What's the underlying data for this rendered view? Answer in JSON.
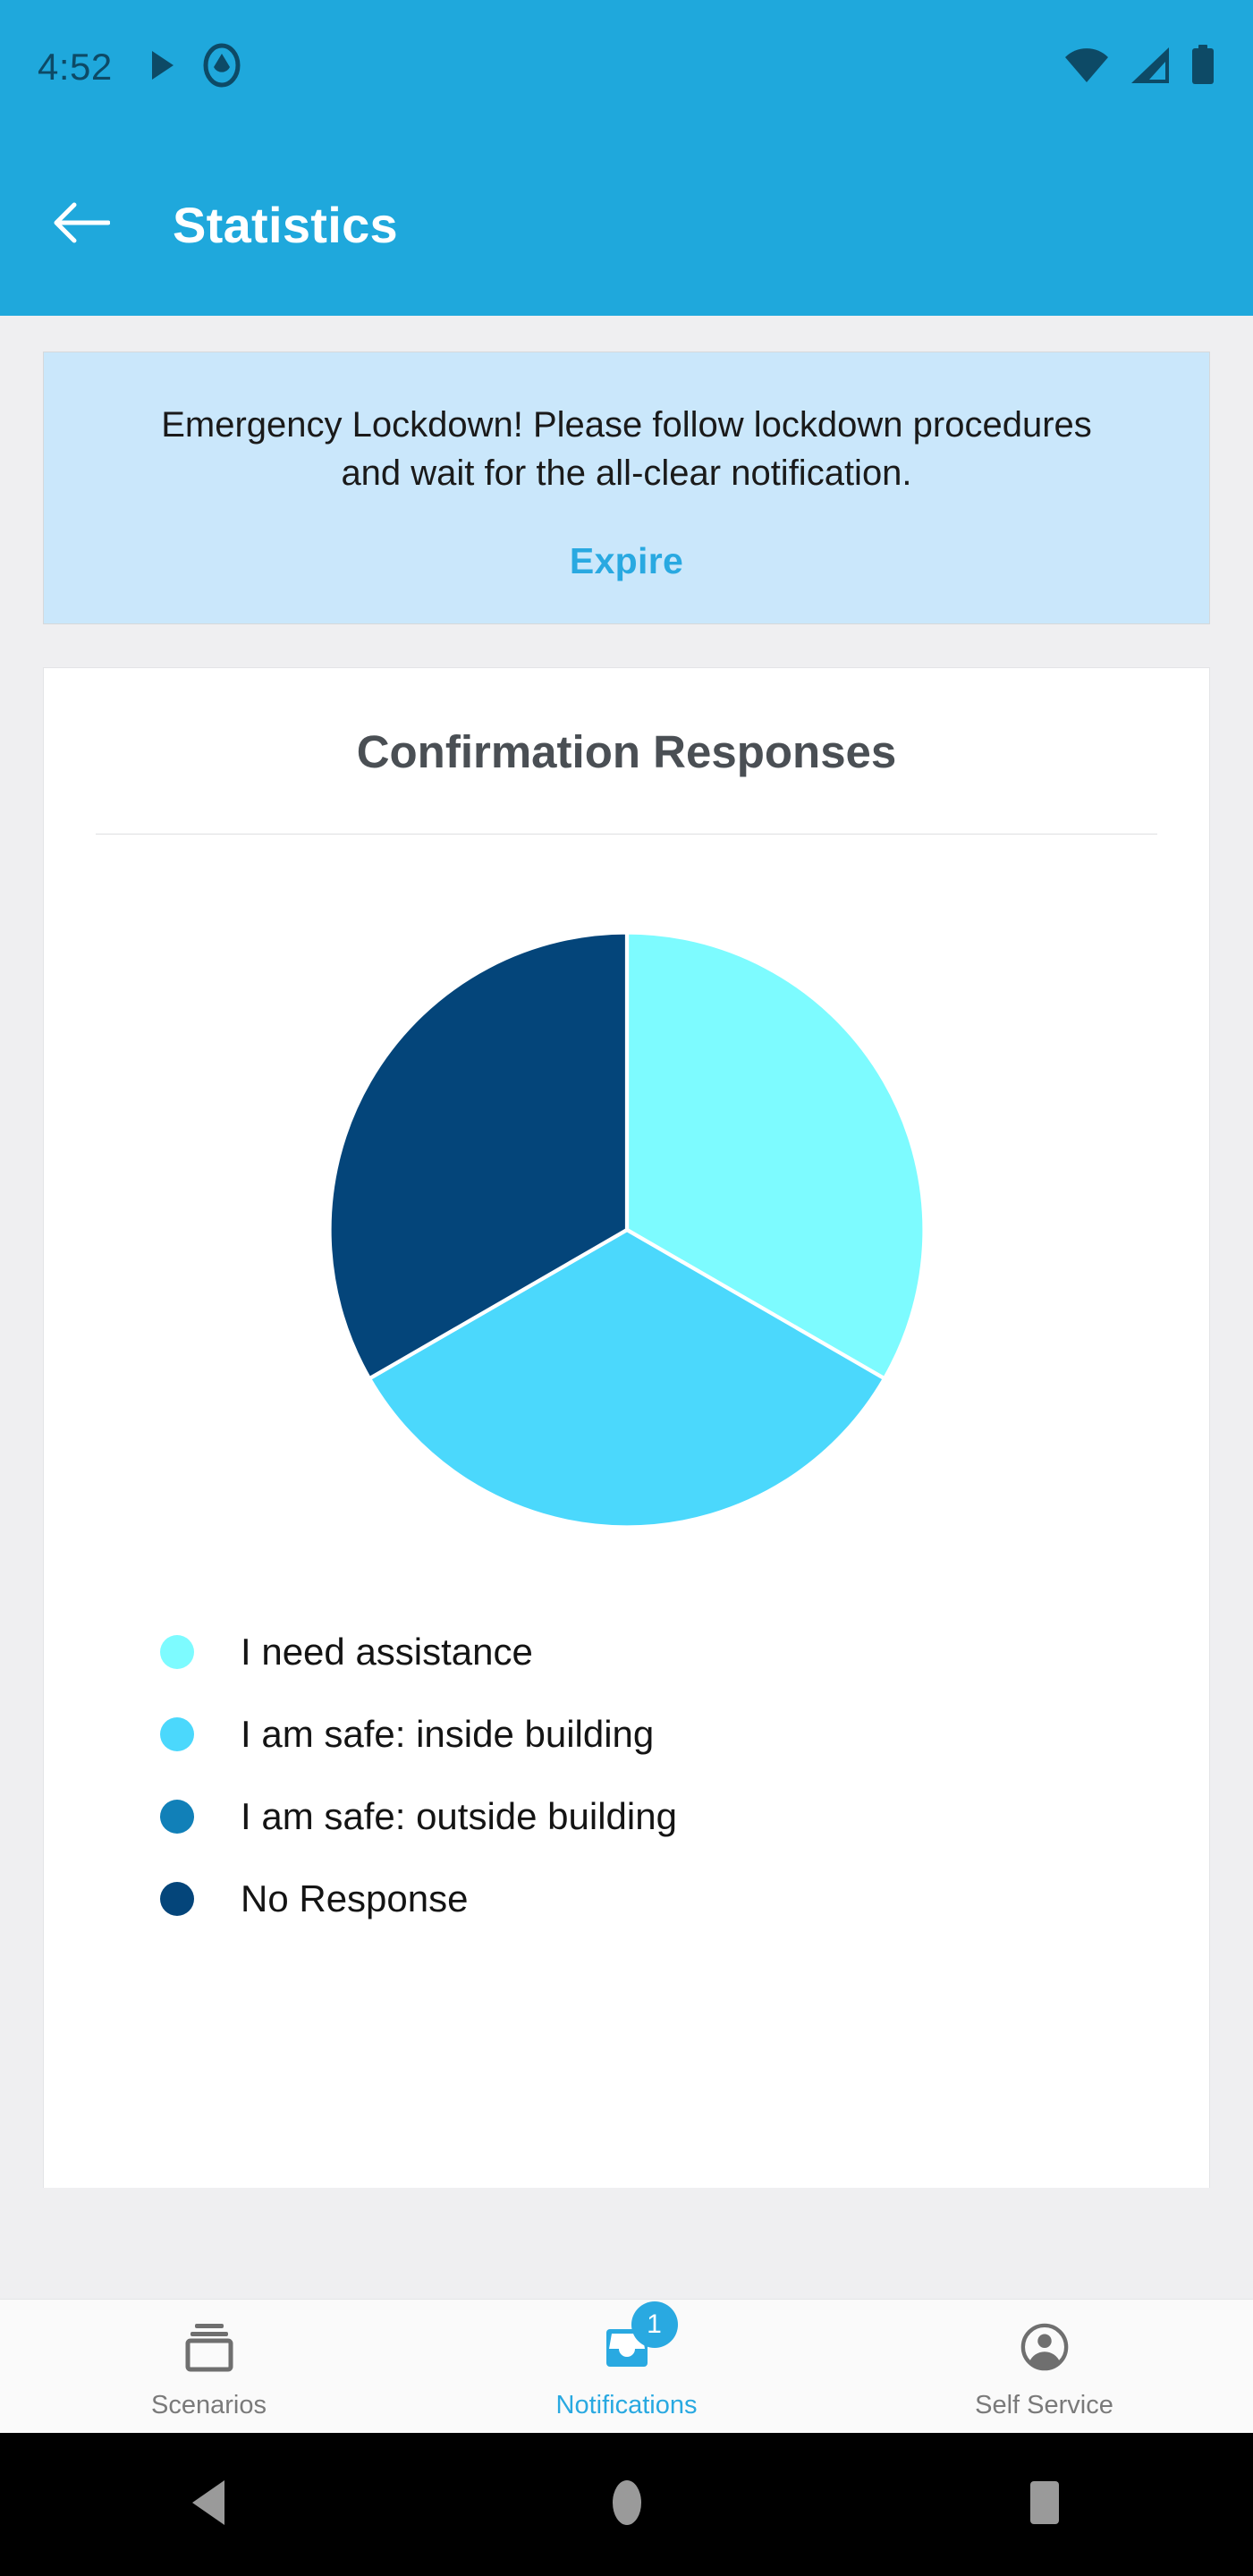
{
  "statusbar": {
    "time": "4:52",
    "icons": [
      "play-icon",
      "do-not-disturb-icon"
    ],
    "right_icons": [
      "wifi-icon",
      "cellular-signal-icon",
      "battery-icon"
    ],
    "foreground_color": "#0d4a66",
    "background_color": "#1fa8dc"
  },
  "appbar": {
    "back_icon": "back-arrow-icon",
    "title": "Statistics",
    "background_color": "#1fa8dc",
    "title_color": "#ffffff"
  },
  "alert": {
    "message": "Emergency Lockdown! Please follow lockdown procedures and wait for the all-clear notification.",
    "action_label": "Expire",
    "background_color": "#cae7fb",
    "action_color": "#29a9e1"
  },
  "chart_card": {
    "title": "Confirmation Responses"
  },
  "chart_data": {
    "type": "pie",
    "title": "Confirmation Responses",
    "categories": [
      "I need assistance",
      "I am safe: inside building",
      "I am safe: outside building",
      "No Response"
    ],
    "values": [
      1,
      1,
      0,
      1
    ],
    "percentages": [
      33.3,
      33.3,
      0,
      33.3
    ],
    "colors": [
      "#7dfbff",
      "#4bd8fc",
      "#1180b8",
      "#04457a"
    ],
    "legend_position": "bottom",
    "start_angle": 0,
    "direction": "clockwise",
    "slice_border_color": "#ffffff",
    "legend": [
      {
        "label": "I need assistance",
        "color": "#7dfbff"
      },
      {
        "label": "I am safe: inside building",
        "color": "#4bd8fc"
      },
      {
        "label": "I am safe: outside building",
        "color": "#1180b8"
      },
      {
        "label": "No Response",
        "color": "#04457a"
      }
    ]
  },
  "bottomnav": {
    "tabs": [
      {
        "label": "Scenarios",
        "icon": "scenarios-stack-icon",
        "active": false,
        "badge": ""
      },
      {
        "label": "Notifications",
        "icon": "inbox-icon",
        "active": true,
        "badge": "1"
      },
      {
        "label": "Self Service",
        "icon": "account-circle-icon",
        "active": false,
        "badge": ""
      }
    ],
    "active_color": "#29a9e1",
    "inactive_color": "#7a7a7a"
  },
  "androidnav": {
    "buttons": [
      "back-triangle-icon",
      "home-circle-icon",
      "recents-square-icon"
    ],
    "color": "#9a9a9a",
    "background_color": "#000000"
  }
}
